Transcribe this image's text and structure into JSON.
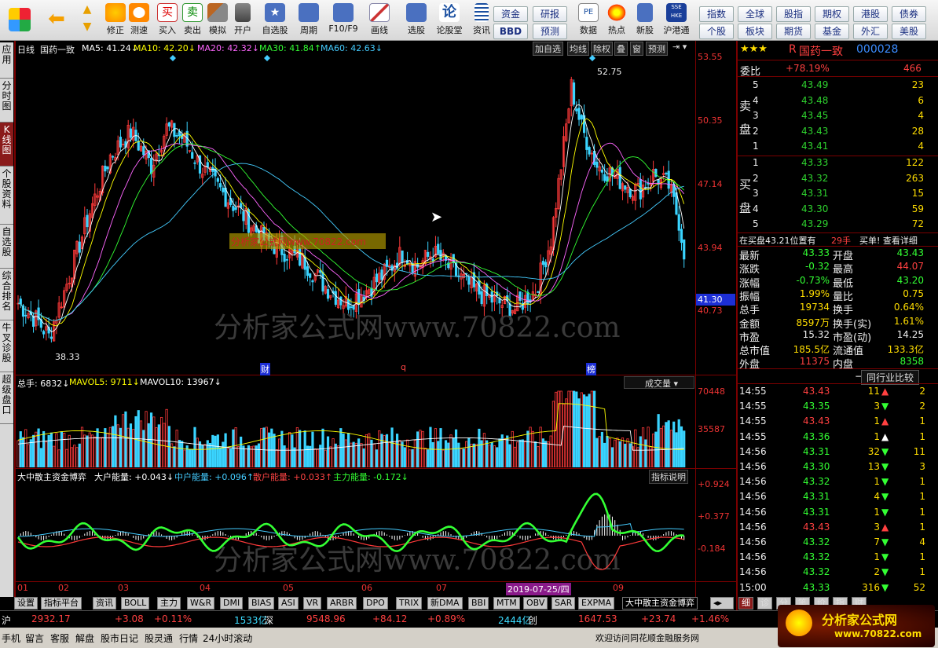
{
  "toolbar": {
    "buttons": [
      "修正",
      "测速",
      "买入",
      "卖出",
      "模拟",
      "开户",
      "自选股",
      "周期",
      "F10/F9",
      "画线",
      "选股",
      "论股堂",
      "资讯",
      "数据",
      "热点",
      "新股",
      "沪港通"
    ],
    "grid_buttons": [
      "资金",
      "研报",
      "BBD",
      "预测"
    ],
    "right_buttons": [
      "指数",
      "全球",
      "股指",
      "期权",
      "港股",
      "债券",
      "个股",
      "板块",
      "期货",
      "基金",
      "外汇",
      "美股"
    ]
  },
  "left_tabs": [
    "应用",
    "分时图",
    "K线图",
    "个股资料",
    "自选股",
    "综合排名",
    "牛叉诊股",
    "超级盘口"
  ],
  "chart": {
    "period_label": "日线",
    "stock_name": "国药一致",
    "ma": [
      {
        "label": "MA5: 41.24↓",
        "color": "#ffffff"
      },
      {
        "label": "MA10: 42.20↓",
        "color": "#ffff00"
      },
      {
        "label": "MA20: 42.32↓",
        "color": "#ff66ff"
      },
      {
        "label": "MA30: 41.84↑",
        "color": "#33ff33"
      },
      {
        "label": "MA60: 42.63↓",
        "color": "#44ccff"
      }
    ],
    "top_buttons": [
      "加自选",
      "均线",
      "除权",
      "叠",
      "窗",
      "预测"
    ],
    "price_axis": [
      "53.55",
      "50.35",
      "47.14",
      "43.94",
      "40.73"
    ],
    "current_price_tag": "41.30",
    "high_label": "52.75",
    "low_label": "38.33",
    "event_markers": [
      "财",
      "q",
      "榜"
    ],
    "watermark": "分析家公式网www.70822.com",
    "watermark_box": "分析家公式网www.70822.com"
  },
  "volume": {
    "title": "总手: 6832↓ MAVOL5: 9711↓ MAVOL10: 13967↓",
    "parts": [
      {
        "label": "总手: 6832↓",
        "color": "#ffffff"
      },
      {
        "label": "MAVOL5: 9711↓",
        "color": "#ffff00"
      },
      {
        "label": "MAVOL10: 13967↓",
        "color": "#ffffff"
      }
    ],
    "dropdown": "成交量",
    "axis": [
      "70448",
      "35587"
    ]
  },
  "indicator": {
    "parts": [
      {
        "label": "大中散主资金博弈",
        "color": "#ffffff"
      },
      {
        "label": "大户能量: +0.043↓",
        "color": "#ffffff"
      },
      {
        "label": "中户能量: +0.096↑",
        "color": "#44ccff"
      },
      {
        "label": "散户能量: +0.033↑",
        "color": "#ff4444"
      },
      {
        "label": "主力能量: -0.172↓",
        "color": "#33ff33"
      }
    ],
    "explain_button": "指标说明",
    "axis": [
      "+0.924",
      "+0.377",
      "-0.184"
    ]
  },
  "date_axis": [
    "01",
    "02",
    "03",
    "04",
    "05",
    "06",
    "07",
    "09"
  ],
  "date_cursor": "2019-07-25/四",
  "bottom_tabs": [
    "设置",
    "指标平台",
    "资讯",
    "BOLL",
    "主力",
    "W&R",
    "DMI",
    "BIAS",
    "ASI",
    "VR",
    "ARBR",
    "DPO",
    "TRIX",
    "新DMA",
    "BBI",
    "MTM",
    "OBV",
    "SAR",
    "EXPMA",
    "大中散主资金博弈"
  ],
  "quote": {
    "stars": "★★★",
    "prefix": "R",
    "name": "国药一致",
    "code": "000028",
    "weibi_label": "委比",
    "weibi": "+78.19%",
    "weicha": "466",
    "sell_label": "卖盘",
    "buy_label": "买盘",
    "sell": [
      {
        "n": "5",
        "p": "43.49",
        "v": "23"
      },
      {
        "n": "4",
        "p": "43.48",
        "v": "6"
      },
      {
        "n": "3",
        "p": "43.45",
        "v": "4"
      },
      {
        "n": "2",
        "p": "43.43",
        "v": "28"
      },
      {
        "n": "1",
        "p": "43.41",
        "v": "4"
      }
    ],
    "buy": [
      {
        "n": "1",
        "p": "43.33",
        "v": "122"
      },
      {
        "n": "2",
        "p": "43.32",
        "v": "263"
      },
      {
        "n": "3",
        "p": "43.31",
        "v": "15"
      },
      {
        "n": "4",
        "p": "43.30",
        "v": "59"
      },
      {
        "n": "5",
        "p": "43.29",
        "p2": "",
        "v": "72"
      }
    ],
    "order_info": "在买盘43.21位置有",
    "order_qty": "29手",
    "order_link": "买单! 查看详细",
    "stats": [
      {
        "l": "最新",
        "v": "43.33",
        "vc": "#33ff33",
        "l2": "开盘",
        "v2": "43.43",
        "v2c": "#33ff33"
      },
      {
        "l": "涨跌",
        "v": "-0.32",
        "vc": "#33ff33",
        "l2": "最高",
        "v2": "44.07",
        "v2c": "#ff4040"
      },
      {
        "l": "涨幅",
        "v": "-0.73%",
        "vc": "#33ff33",
        "l2": "最低",
        "v2": "43.20",
        "v2c": "#33ff33"
      },
      {
        "l": "振幅",
        "v": "1.99%",
        "vc": "#ffdd00",
        "l2": "量比",
        "v2": "0.75",
        "v2c": "#ffdd00"
      },
      {
        "l": "总手",
        "v": "19734",
        "vc": "#ffdd00",
        "l2": "换手",
        "v2": "0.64%",
        "v2c": "#ffdd00"
      },
      {
        "l": "金额",
        "v": "8597万",
        "vc": "#ffdd00",
        "l2": "换手(实)",
        "v2": "1.61%",
        "v2c": "#ffdd00"
      },
      {
        "l": "市盈",
        "v": "15.32",
        "vc": "#eeeeee",
        "l2": "市盈(动)",
        "v2": "14.25",
        "v2c": "#eeeeee"
      },
      {
        "l": "总市值",
        "v": "185.5亿",
        "vc": "#ffdd00",
        "l2": "流通值",
        "v2": "133.3亿",
        "v2c": "#ffdd00"
      },
      {
        "l": "外盘",
        "v": "11375",
        "vc": "#ff4040",
        "l2": "内盘",
        "v2": "8358",
        "v2c": "#33ff33"
      }
    ],
    "compare_tab": "同行业比较",
    "ticks": [
      {
        "t": "14:55",
        "p": "43.43",
        "v": "11",
        "d": "up",
        "n": "2"
      },
      {
        "t": "14:55",
        "p": "43.35",
        "v": "3",
        "d": "down",
        "n": "2"
      },
      {
        "t": "14:55",
        "p": "43.43",
        "v": "1",
        "d": "up",
        "n": "1"
      },
      {
        "t": "14:55",
        "p": "43.36",
        "v": "1",
        "d": "upw",
        "n": "1"
      },
      {
        "t": "14:56",
        "p": "43.31",
        "v": "32",
        "d": "down",
        "n": "11"
      },
      {
        "t": "14:56",
        "p": "43.30",
        "v": "13",
        "d": "down",
        "n": "3"
      },
      {
        "t": "14:56",
        "p": "43.32",
        "v": "1",
        "d": "down",
        "n": "1"
      },
      {
        "t": "14:56",
        "p": "43.31",
        "v": "4",
        "d": "down",
        "n": "1"
      },
      {
        "t": "14:56",
        "p": "43.31",
        "v": "1",
        "d": "down",
        "n": "1"
      },
      {
        "t": "14:56",
        "p": "43.43",
        "v": "3",
        "d": "up",
        "n": "1"
      },
      {
        "t": "14:56",
        "p": "43.32",
        "v": "7",
        "d": "down",
        "n": "4"
      },
      {
        "t": "14:56",
        "p": "43.32",
        "v": "1",
        "d": "down",
        "n": "1"
      },
      {
        "t": "14:56",
        "p": "43.32",
        "v": "2",
        "d": "down",
        "n": "1"
      },
      {
        "t": "15:00",
        "p": "43.33",
        "v": "316",
        "d": "down",
        "n": "52"
      }
    ],
    "right_tabs": [
      "细",
      "诊",
      "分",
      "笔",
      "价",
      "指",
      "财"
    ]
  },
  "status": {
    "sh_label": "沪",
    "sh_index": "2932.17",
    "sh_chg": "+3.08",
    "sh_pct": "+0.11%",
    "sh_amt": "1533亿",
    "sz_label": "深",
    "sz_index": "9548.96",
    "sz_chg": "+84.12",
    "sz_pct": "+0.89%",
    "cy_amt": "2444亿",
    "cy_label": "创",
    "cy_index": "1647.53",
    "cy_chg": "+23.74",
    "cy_pct": "+1.46%"
  },
  "bottom_bar": {
    "items": [
      "手机",
      "留言",
      "客服",
      "解盘",
      "股市日记",
      "股灵通",
      "行情",
      "24小时滚动"
    ],
    "welcome": "欢迎访问同花顺金融服务网",
    "logo_text": "分析家公式网",
    "logo_url": "www.70822.com"
  }
}
